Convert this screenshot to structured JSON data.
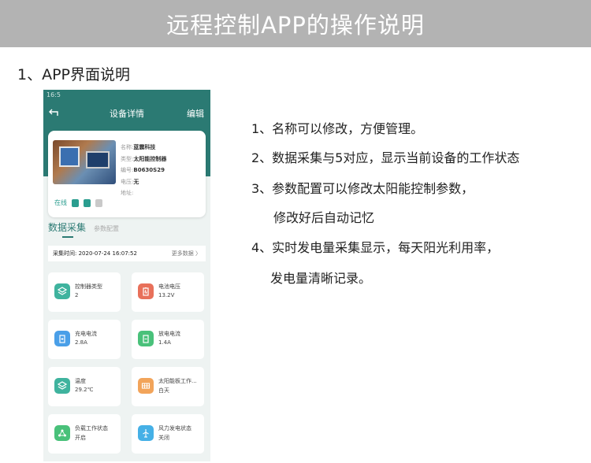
{
  "banner": {
    "title": "远程控制APP的操作说明"
  },
  "section_heading": "1、APP界面说明",
  "phone": {
    "status_time": "16:5",
    "nav": {
      "title": "设备详情",
      "edit": "编辑"
    },
    "device": {
      "rows": [
        {
          "key": "名称:",
          "value": "蓝震科技"
        },
        {
          "key": "类型:",
          "value": "太阳能控制器"
        },
        {
          "key": "编号:",
          "value": "B0630S29"
        },
        {
          "key": "电压:",
          "value": "无"
        },
        {
          "key": "地址:",
          "value": ""
        }
      ],
      "status": "在线"
    },
    "tabs": {
      "active": "数据采集",
      "inactive": "参数配置"
    },
    "collect": {
      "label": "采集时间: 2020-07-24 16:07:52",
      "more": "更多数据 〉"
    },
    "tiles": [
      {
        "label": "控制器类型",
        "value": "2",
        "icon": "layers-icon",
        "color": "#3fb39e"
      },
      {
        "label": "电池电压",
        "value": "13.2V",
        "icon": "battery-icon",
        "color": "#e8705a"
      },
      {
        "label": "充电电流",
        "value": "2.8A",
        "icon": "charge-icon",
        "color": "#4a9fe8"
      },
      {
        "label": "放电电流",
        "value": "1.4A",
        "icon": "discharge-icon",
        "color": "#49c17a"
      },
      {
        "label": "温度",
        "value": "29.2℃",
        "icon": "temperature-icon",
        "color": "#3fb39e"
      },
      {
        "label": "太阳能板工作...",
        "value": "白天",
        "icon": "solar-panel-icon",
        "color": "#f2a45a"
      },
      {
        "label": "负载工作状态",
        "value": "开启",
        "icon": "load-icon",
        "color": "#49c17a"
      },
      {
        "label": "风力发电状态",
        "value": "关闭",
        "icon": "wind-turbine-icon",
        "color": "#45b0e6"
      }
    ]
  },
  "notes": [
    "1、名称可以修改，方便管理。",
    "2、数据采集与5对应，显示当前设备的工作状态",
    "3、参数配置可以修改太阳能控制参数，",
    "修改好后自动记忆",
    "4、实时发电量采集显示，每天阳光利用率，",
    "发电量清晰记录。"
  ]
}
